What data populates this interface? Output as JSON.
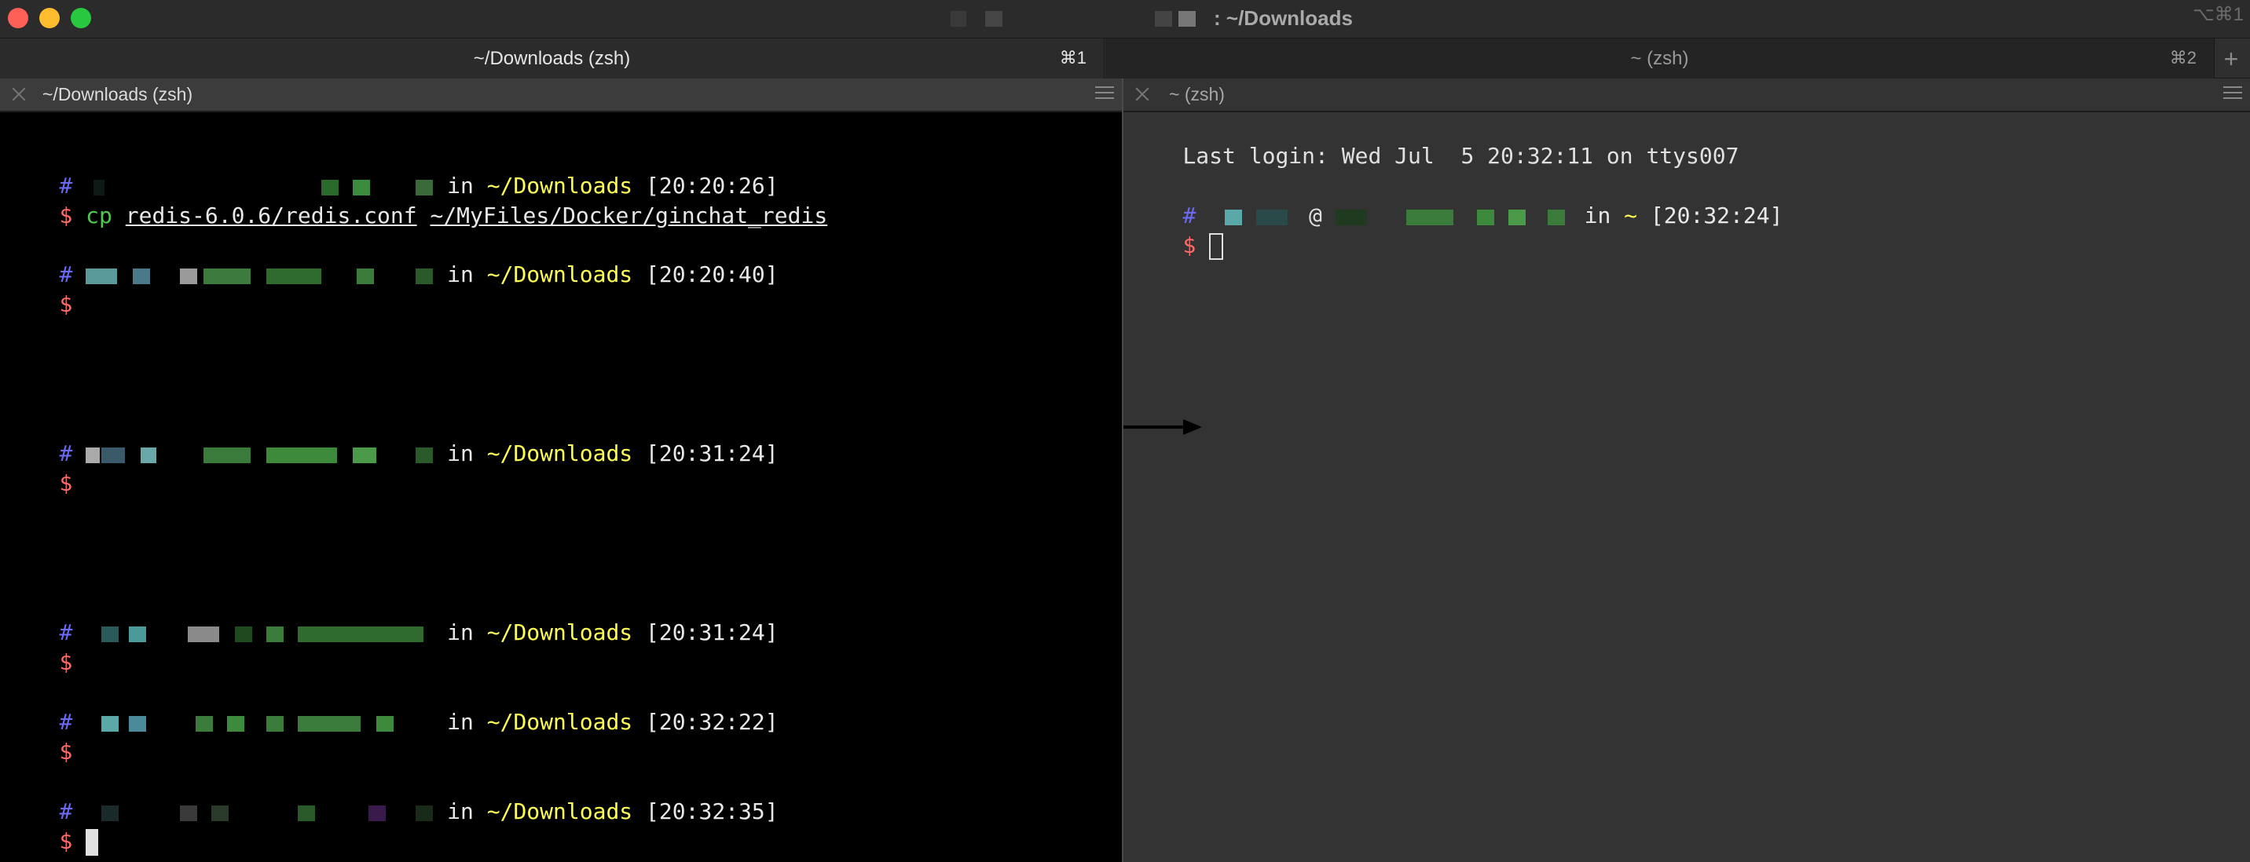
{
  "window": {
    "title": ": ~/Downloads",
    "shortcut": "⌥⌘1"
  },
  "tabs": [
    {
      "label": "~/Downloads (zsh)",
      "key": "⌘1",
      "active": true
    },
    {
      "label": "~ (zsh)",
      "key": "⌘2",
      "active": false
    }
  ],
  "add_tab": "+",
  "left_pane": {
    "title": "~/Downloads (zsh)",
    "in": "in",
    "dir": "~/Downloads",
    "hash": "#",
    "dollar": "$",
    "prompts": [
      {
        "time": "[20:20:26]",
        "command": "cp",
        "args": [
          "redis-6.0.6/redis.conf",
          "~/MyFiles/Docker/ginchat_redis"
        ]
      },
      {
        "time": "[20:20:40]"
      },
      {
        "time": "[20:31:24]"
      },
      {
        "time": "[20:31:24]"
      },
      {
        "time": "[20:32:22]"
      },
      {
        "time": "[20:32:35]"
      }
    ]
  },
  "right_pane": {
    "title": "~ (zsh)",
    "last_login": "Last login: Wed Jul  5 20:32:11 on ttys007",
    "hash": "#",
    "at": "@",
    "in": "in",
    "dir": "~",
    "time": "[20:32:24]",
    "dollar": "$"
  },
  "icons": {
    "close": "close-icon",
    "menu": "hamburger-menu-icon",
    "arrow": "right-arrow-icon"
  }
}
